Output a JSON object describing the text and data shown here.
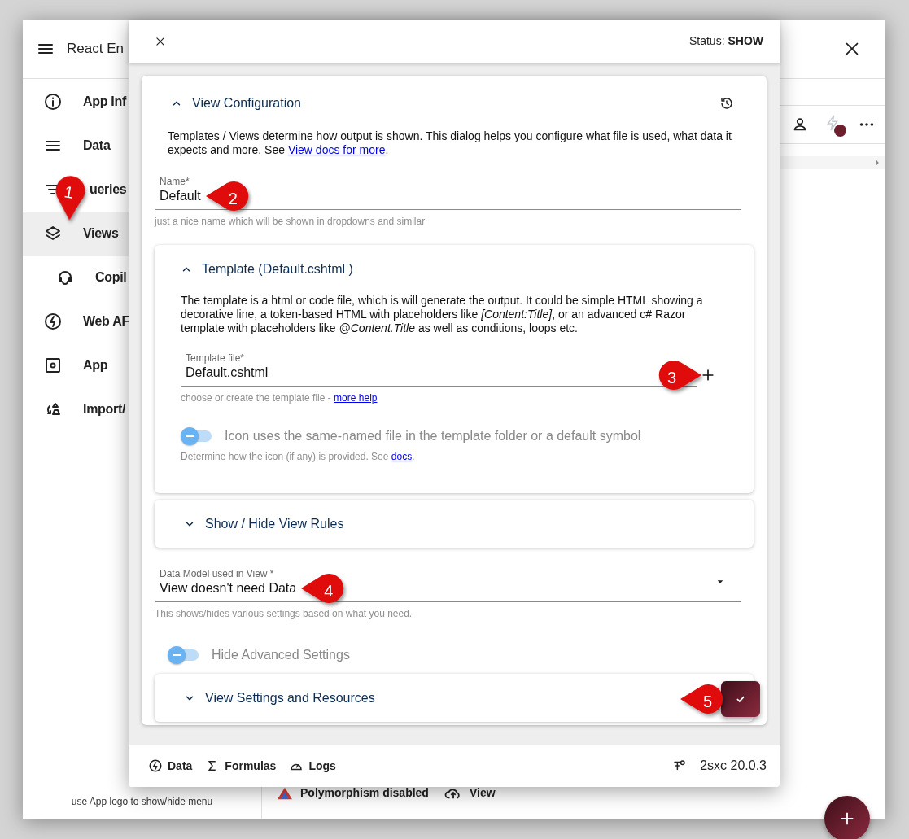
{
  "app": {
    "title": "React En",
    "sidebar": {
      "items": [
        {
          "label": "App Inf",
          "selected": false
        },
        {
          "label": "Data",
          "selected": false
        },
        {
          "label": "ueries",
          "selected": false
        },
        {
          "label": "Views",
          "selected": true,
          "children": [
            {
              "label": "Copil",
              "selected": false
            }
          ]
        },
        {
          "label": "Web AF",
          "selected": false
        },
        {
          "label": "App",
          "selected": false
        },
        {
          "label": "Import/",
          "selected": false
        }
      ]
    },
    "sidebar_hint": "use App logo to show/hide menu",
    "toolbar": [
      {
        "label": "Polymorphism disabled"
      },
      {
        "label": "View"
      }
    ]
  },
  "dialog": {
    "status_label": "Status:",
    "status_value": "SHOW",
    "card": {
      "title": "View Configuration",
      "expanded": true,
      "intro": {
        "text": "Templates / Views determine how output is shown. This dialog helps you configure what file is used, what data it expects and more. See ",
        "link": "View docs for more",
        "after": "."
      },
      "name_field": {
        "label": "Name*",
        "value": "Default",
        "helper": "just a nice name which will be shown in dropdowns and similar"
      },
      "template": {
        "title": "Template (Default.cshtml )",
        "expanded": true,
        "text": "The template is a html or code file, which is will generate the output. It could be simple HTML showing a decorative line, a token-based HTML with placeholders like *[Content:Title]*, or an advanced c# Razor template with placeholders like *@Content.Title* as well as conditions, loops etc.",
        "file_field": {
          "label": "Template file*",
          "value": "Default.cshtml",
          "helper": "choose or create the template file - ",
          "helper_link": "more help"
        },
        "toggle": {
          "label": "Icon uses the same-named file in the template folder or a default symbol",
          "on": false,
          "helper": "Determine how the icon (if any) is provided. See ",
          "helper_link": "docs",
          "helper_after": "."
        }
      },
      "rules": {
        "title": "Show / Hide View Rules",
        "expanded": false
      },
      "data_model": {
        "label": "Data Model used in View *",
        "value": "View doesn't need Data",
        "helper": "This shows/hides various settings based on what you need."
      },
      "advanced_toggle": {
        "label": "Hide Advanced Settings",
        "on": false
      },
      "settings": {
        "title": "View Settings and Resources",
        "expanded": false
      }
    },
    "footer": {
      "buttons": [
        {
          "label": "Data"
        },
        {
          "label": "Formulas"
        },
        {
          "label": "Logs"
        }
      ],
      "version": "2sxc 20.0.3"
    }
  },
  "markers": [
    "1",
    "2",
    "3",
    "4",
    "5"
  ]
}
